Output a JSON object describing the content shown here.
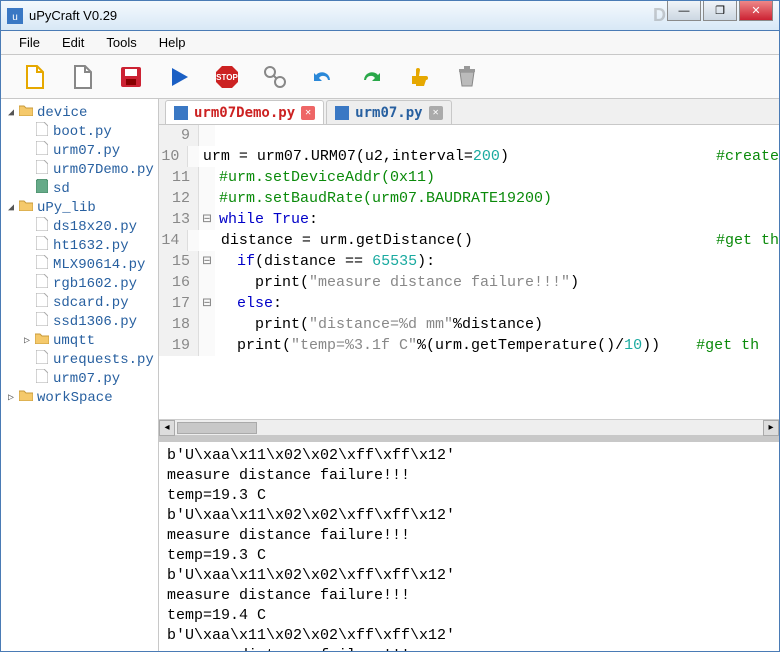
{
  "window": {
    "title": "uPyCraft V0.29"
  },
  "watermark": "DF",
  "win_controls": {
    "min": "—",
    "max": "❐",
    "close": "✕"
  },
  "menus": [
    {
      "label": "File"
    },
    {
      "label": "Edit"
    },
    {
      "label": "Tools"
    },
    {
      "label": "Help"
    }
  ],
  "toolbar_icons": [
    "new-file-icon",
    "open-file-icon",
    "save-icon",
    "run-icon",
    "stop-icon",
    "connect-icon",
    "undo-icon",
    "redo-icon",
    "thumb-icon",
    "trash-icon"
  ],
  "tree": [
    {
      "type": "folder",
      "expand": "◢",
      "label": "device",
      "level": 0
    },
    {
      "type": "file",
      "label": "boot.py",
      "level": 1
    },
    {
      "type": "file",
      "label": "urm07.py",
      "level": 1
    },
    {
      "type": "file",
      "label": "urm07Demo.py",
      "level": 1
    },
    {
      "type": "sd",
      "label": "sd",
      "level": 1
    },
    {
      "type": "folder",
      "expand": "◢",
      "label": "uPy_lib",
      "level": 0
    },
    {
      "type": "file",
      "label": "ds18x20.py",
      "level": 1
    },
    {
      "type": "file",
      "label": "ht1632.py",
      "level": 1
    },
    {
      "type": "file",
      "label": "MLX90614.py",
      "level": 1
    },
    {
      "type": "file",
      "label": "rgb1602.py",
      "level": 1
    },
    {
      "type": "file",
      "label": "sdcard.py",
      "level": 1
    },
    {
      "type": "file",
      "label": "ssd1306.py",
      "level": 1
    },
    {
      "type": "folder",
      "expand": "▷",
      "label": "umqtt",
      "level": 1
    },
    {
      "type": "file",
      "label": "urequests.py",
      "level": 1
    },
    {
      "type": "file",
      "label": "urm07.py",
      "level": 1
    },
    {
      "type": "folder",
      "expand": "▷",
      "label": "workSpace",
      "level": 0
    }
  ],
  "tabs": [
    {
      "label": "urm07Demo.py",
      "color": "#c22",
      "active": true
    },
    {
      "label": "urm07.py",
      "color": "#2860a0",
      "active": false
    }
  ],
  "code": [
    {
      "n": 9,
      "fold": "",
      "html": ""
    },
    {
      "n": 10,
      "fold": "",
      "html": "urm = urm07.URM07(u2,interval=<span class='num'>200</span>)                       <span class='cmt'>#create</span>"
    },
    {
      "n": 11,
      "fold": "",
      "html": "<span class='cmt'>#urm.setDeviceAddr(0x11)</span>"
    },
    {
      "n": 12,
      "fold": "",
      "html": "<span class='cmt'>#urm.setBaudRate(urm07.BAUDRATE19200)</span>"
    },
    {
      "n": 13,
      "fold": "⊟",
      "html": "<span class='kw'>while</span> <span class='kw'>True</span>:"
    },
    {
      "n": 14,
      "fold": "",
      "html": "  distance = urm.getDistance()                           <span class='cmt'>#get th</span>"
    },
    {
      "n": 15,
      "fold": "⊟",
      "html": "  <span class='kw'>if</span>(distance == <span class='num'>65535</span>):"
    },
    {
      "n": 16,
      "fold": "",
      "html": "    print(<span class='str'>\"measure distance failure!!!\"</span>)"
    },
    {
      "n": 17,
      "fold": "⊟",
      "html": "  <span class='kw'>else</span>:"
    },
    {
      "n": 18,
      "fold": "",
      "html": "    print(<span class='str'>\"distance=%d mm\"</span>%distance)"
    },
    {
      "n": 19,
      "fold": "",
      "html": "  print(<span class='str'>\"temp=%3.1f C\"</span>%(urm.getTemperature()/<span class='num'>10</span>))    <span class='cmt'>#get th</span>"
    }
  ],
  "console_lines": [
    "b'U\\xaa\\x11\\x02\\x02\\xff\\xff\\x12'",
    "measure distance failure!!!",
    "temp=19.3 C",
    "b'U\\xaa\\x11\\x02\\x02\\xff\\xff\\x12'",
    "measure distance failure!!!",
    "temp=19.3 C",
    "b'U\\xaa\\x11\\x02\\x02\\xff\\xff\\x12'",
    "measure distance failure!!!",
    "temp=19.4 C",
    "b'U\\xaa\\x11\\x02\\x02\\xff\\xff\\x12'",
    "measure distance failure!!!"
  ]
}
